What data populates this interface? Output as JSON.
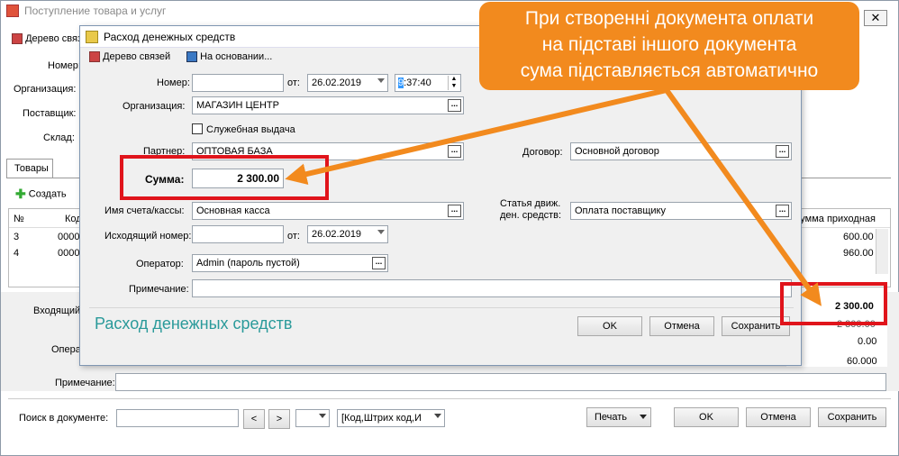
{
  "bg_window": {
    "title": "Поступление товара и услуг",
    "tree_label": "Дерево связей",
    "fields": {
      "number": "Номер:",
      "org": "Организация:",
      "supplier": "Поставщик:",
      "warehouse": "Склад:"
    },
    "tab": "Товары",
    "add_label": "Создать",
    "columns": {
      "num": "№",
      "code": "Код",
      "sum": "Сумма приходная"
    },
    "rows": [
      {
        "num": "3",
        "code": "0000",
        "sum": "600.00"
      },
      {
        "num": "4",
        "code": "0000",
        "sum": "960.00"
      }
    ],
    "incoming_label": "Входящий",
    "operator_label": "Опера",
    "totals": {
      "total": "2 300.00",
      "paid": "2 300.00",
      "zero": "0.00",
      "sixty": "60.000"
    },
    "note_label": "Примечание:",
    "search_label": "Поиск в документе:",
    "search_value": "",
    "prev_btn": "<",
    "next_btn": ">",
    "fields_select": "[Код,Штрих код,И",
    "print_btn": "Печать",
    "ok_btn": "OK",
    "cancel_btn": "Отмена",
    "save_btn": "Сохранить"
  },
  "dialog": {
    "title": "Расход денежных средств",
    "tree_label": "Дерево связей",
    "based_on": "На основании...",
    "number_label": "Номер:",
    "number_value": "",
    "from_label": "от:",
    "date_value": "26.02.2019",
    "time_value": "9:37:40",
    "time_highlight": "9",
    "time_rest": ":37:40",
    "org_label": "Организация:",
    "org_value": "МАГАЗИН ЦЕНТР",
    "service_label": "Служебная выдача",
    "partner_label": "Партнер:",
    "partner_value": "ОПТОВАЯ БАЗА",
    "contract_label": "Договор:",
    "contract_value": "Основной договор",
    "sum_label": "Сумма:",
    "sum_value": "2 300.00",
    "account_label": "Имя счета/кассы:",
    "account_value": "Основная касса",
    "flow_label_1": "Статья движ.",
    "flow_label_2": "ден. средств:",
    "flow_value": "Оплата поставщику",
    "out_number_label": "Исходящий номер:",
    "out_number_value": "",
    "out_from_label": "от:",
    "out_date_value": "26.02.2019",
    "operator_label": "Оператор:",
    "operator_value": "Admin (пароль пустой)",
    "note_label": "Примечание:",
    "note_value": "",
    "footer_caption": "Расход денежных средств",
    "ok_btn": "OK",
    "cancel_btn": "Отмена",
    "save_btn": "Сохранить"
  },
  "callout": {
    "line1": "При створенні документа оплати",
    "line2": "на підставі іншого документа",
    "line3": "сума підставляється автоматично"
  },
  "colors": {
    "accent_orange": "#f28a1e",
    "highlight_red": "#e0141b",
    "caption_teal": "#2a9a9a"
  }
}
